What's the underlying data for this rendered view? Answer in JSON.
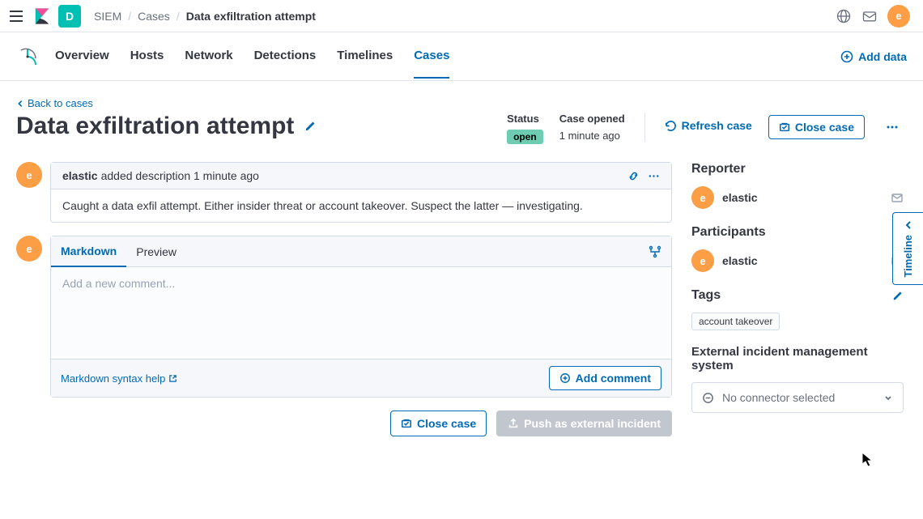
{
  "chrome": {
    "space_letter": "D",
    "breadcrumb": [
      "SIEM",
      "Cases",
      "Data exfiltration attempt"
    ],
    "avatar_letter": "e"
  },
  "nav": {
    "tabs": [
      "Overview",
      "Hosts",
      "Network",
      "Detections",
      "Timelines",
      "Cases"
    ],
    "active": "Cases",
    "add_data": "Add data"
  },
  "page": {
    "back": "Back to cases",
    "title": "Data exfiltration attempt",
    "status_label": "Status",
    "status_value": "open",
    "opened_label": "Case opened",
    "opened_value": "1 minute ago",
    "refresh": "Refresh case",
    "close": "Close case"
  },
  "activity": {
    "desc_user": "elastic",
    "desc_action": "added description 1 minute ago",
    "desc_text": "Caught a data exfil attempt. Either insider threat or account takeover. Suspect the latter — investigating.",
    "tab_md": "Markdown",
    "tab_preview": "Preview",
    "placeholder": "Add a new comment...",
    "md_help": "Markdown syntax help",
    "add_comment": "Add comment"
  },
  "bottom": {
    "close": "Close case",
    "push": "Push as external incident"
  },
  "side": {
    "reporter_h": "Reporter",
    "participants_h": "Participants",
    "tags_h": "Tags",
    "ext_h": "External incident management system",
    "user": "elastic",
    "user_letter": "e",
    "tag": "account takeover",
    "connector": "No connector selected"
  },
  "timeline_flyout": "Timeline"
}
